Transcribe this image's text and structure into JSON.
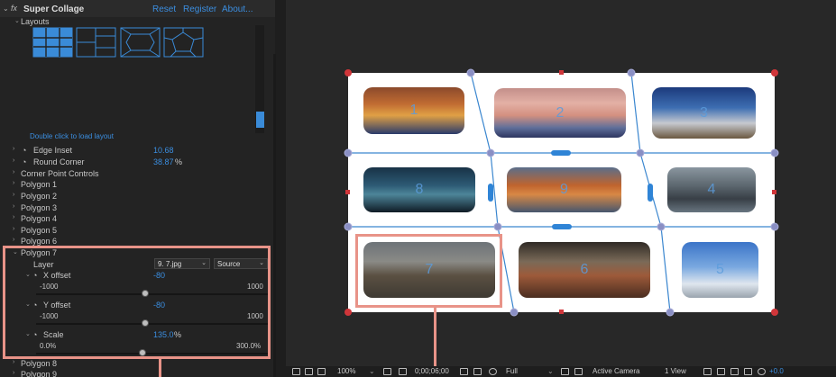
{
  "effect": {
    "fx_label": "fx",
    "title": "Super Collage",
    "links": [
      "Reset",
      "Register",
      "About..."
    ]
  },
  "layouts": {
    "label": "Layouts",
    "hint": "Double click to load layout"
  },
  "params": {
    "edge_inset": {
      "label": "Edge Inset",
      "value": "10.68"
    },
    "round_corner": {
      "label": "Round Corner",
      "value": "38.87",
      "unit": "%"
    },
    "corner_point_controls": "Corner Point Controls",
    "polygons": [
      "Polygon 1",
      "Polygon 2",
      "Polygon 3",
      "Polygon 4",
      "Polygon 5",
      "Polygon 6"
    ],
    "polygon7": {
      "label": "Polygon 7",
      "layer_label": "Layer",
      "layer_value": "9. 7.jpg",
      "source_value": "Source",
      "x_offset": {
        "label": "X offset",
        "value": "-80",
        "min": "-1000",
        "max": "1000",
        "level": 0.46
      },
      "y_offset": {
        "label": "Y offset",
        "value": "-80",
        "min": "-1000",
        "max": "1000",
        "level": 0.46
      },
      "scale": {
        "label": "Scale",
        "value": "135.0",
        "unit": "%",
        "min": "0.0%",
        "max": "300.0%",
        "level": 0.45
      }
    },
    "after": [
      "Polygon 8",
      "Polygon 9"
    ]
  },
  "viewer": {
    "photo_numbers": [
      "1",
      "2",
      "3",
      "8",
      "9",
      "4",
      "7",
      "6",
      "5"
    ]
  },
  "footer": {
    "zoom": "100%",
    "timecode": "0;00;06;00",
    "resolution": "Full",
    "camera": "Active Camera",
    "views": "1 View",
    "exposure": "+0.0"
  },
  "colors": {
    "accent": "#3b8ee0",
    "highlight": "#e89388",
    "handle_red": "#d0363a",
    "handle_blue": "#3a86cf"
  }
}
